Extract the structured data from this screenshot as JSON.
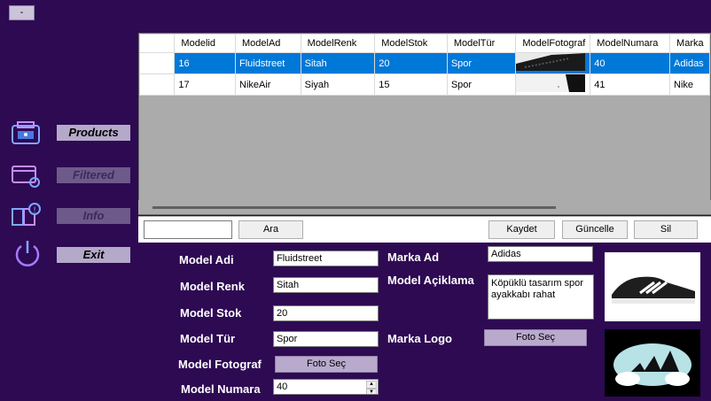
{
  "window": {
    "minimize_label": "-"
  },
  "sidebar": {
    "items": [
      {
        "label": "Products",
        "icon": "products-icon",
        "enabled": true
      },
      {
        "label": "Filtered",
        "icon": "filter-settings-icon",
        "enabled": false
      },
      {
        "label": "Info",
        "icon": "info-icon",
        "enabled": false
      },
      {
        "label": "Exit",
        "icon": "power-icon",
        "enabled": true
      }
    ]
  },
  "grid": {
    "columns": [
      "Modelid",
      "ModelAd",
      "ModelRenk",
      "ModelStok",
      "ModelTür",
      "ModelFotograf",
      "ModelNumara",
      "Marka"
    ],
    "rows": [
      {
        "selected": true,
        "cells": [
          "16",
          "Fluidstreet",
          "Sitah",
          "20",
          "Spor",
          "",
          "40",
          "Adidas"
        ]
      },
      {
        "selected": false,
        "cells": [
          "17",
          "NikeAir",
          "Siyah",
          "15",
          "Spor",
          "",
          "41",
          "Nike"
        ]
      }
    ],
    "selection_color": "#0078d7"
  },
  "toolbar": {
    "search_value": "",
    "search_button": "Ara",
    "save_button": "Kaydet",
    "update_button": "Güncelle",
    "delete_button": "Sil"
  },
  "form": {
    "model_adi_label": "Model Adi",
    "model_adi_value": "Fluidstreet",
    "model_renk_label": "Model Renk",
    "model_renk_value": "Sitah",
    "model_stok_label": "Model Stok",
    "model_stok_value": "20",
    "model_tur_label": "Model Tür",
    "model_tur_value": "Spor",
    "model_fotograf_label": "Model Fotograf",
    "foto_sec_button": "Foto Seç",
    "model_numara_label": "Model Numara",
    "model_numara_value": "40",
    "marka_ad_label": "Marka Ad",
    "marka_ad_value": "Adidas",
    "model_aciklama_label": "Model Açiklama",
    "model_aciklama_value": "Köpüklü tasarım spor ayakkabı rahat",
    "marka_logo_label": "Marka Logo",
    "marka_foto_sec_button": "Foto Seç"
  },
  "colors": {
    "background": "#2d0a52",
    "accent": "#b5a9c9"
  }
}
